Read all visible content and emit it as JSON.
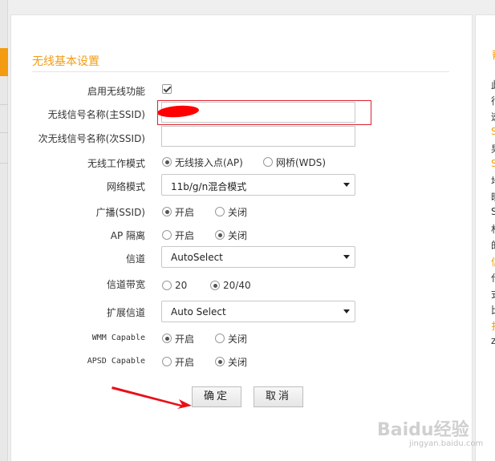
{
  "section_title": "无线基本设置",
  "form": {
    "enable_wireless": {
      "label": "启用无线功能",
      "checked": true
    },
    "ssid": {
      "label": "无线信号名称(主SSID)",
      "value": ""
    },
    "ssid2": {
      "label": "次无线信号名称(次SSID)",
      "value": ""
    },
    "work_mode": {
      "label": "无线工作模式",
      "options": [
        "无线接入点(AP)",
        "网桥(WDS)"
      ],
      "selected": 0
    },
    "network_mode": {
      "label": "网络模式",
      "value": "11b/g/n混合模式"
    },
    "broadcast": {
      "label": "广播(SSID)",
      "options": [
        "开启",
        "关闭"
      ],
      "selected": 0
    },
    "ap_isolation": {
      "label": "AP 隔离",
      "options": [
        "开启",
        "关闭"
      ],
      "selected": 1
    },
    "channel": {
      "label": "信道",
      "value": "AutoSelect"
    },
    "bandwidth": {
      "label": "信道带宽",
      "options": [
        "20",
        "20/40"
      ],
      "selected": 1
    },
    "ext_channel": {
      "label": "扩展信道",
      "value": "Auto Select"
    },
    "wmm": {
      "label": "WMM Capable",
      "options": [
        "开启",
        "关闭"
      ],
      "selected": 0
    },
    "apsd": {
      "label": "APSD Capable",
      "options": [
        "开启",
        "关闭"
      ],
      "selected": 1
    }
  },
  "buttons": {
    "confirm": "确定",
    "cancel": "取消"
  },
  "help": {
    "title": "帮",
    "chars": [
      "此",
      "行",
      "速",
      "S",
      "果",
      "S",
      "地",
      "旺",
      "S",
      "杉",
      "的",
      "信",
      "代",
      "式",
      "比",
      "扌",
      "z"
    ]
  },
  "watermark": {
    "main": "Baidu经验",
    "sub": "jingyan.baidu.com"
  },
  "colors": {
    "accent": "#f39c12",
    "highlight": "#d9232e",
    "arrow": "#e8101a"
  }
}
